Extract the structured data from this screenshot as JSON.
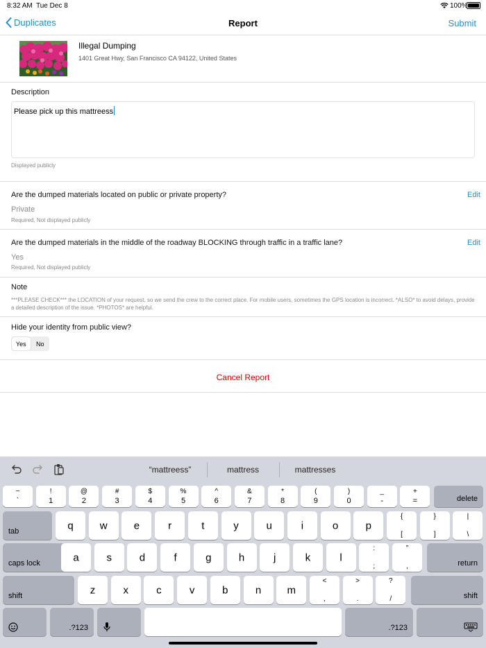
{
  "status": {
    "time": "8:32 AM",
    "day": "Tue Dec 8",
    "battery": "100%"
  },
  "nav": {
    "back_label": "Duplicates",
    "title": "Report",
    "submit_label": "Submit"
  },
  "report": {
    "title": "Illegal Dumping",
    "address": "1401 Great Hwy, San Francisco CA 94122, United States"
  },
  "description": {
    "label": "Description",
    "value": "Please pick up this mattreess",
    "hint": "Displayed publicly"
  },
  "q1": {
    "question": "Are the dumped materials located on public or private property?",
    "edit": "Edit",
    "answer": "Private",
    "hint": "Required, Not displayed publicly"
  },
  "q2": {
    "question": "Are the dumped materials in the middle of the roadway BLOCKING through traffic in a traffic lane?",
    "edit": "Edit",
    "answer": "Yes",
    "hint": "Required, Not displayed publicly"
  },
  "note": {
    "label": "Note",
    "text": "***PLEASE CHECK*** the LOCATION of your request, so we send the crew to the correct place. For mobile users, sometimes the GPS location is incorrect. *ALSO* to avoid delays, provide a detailed description of the issue. *PHOTOS* are helpful."
  },
  "identity": {
    "question": "Hide your identity from public view?",
    "yes": "Yes",
    "no": "No",
    "selected": "Yes"
  },
  "cancel_label": "Cancel Report",
  "colors": {
    "accent": "#1e8fc9",
    "danger": "#d90000"
  },
  "keyboard": {
    "suggestions": [
      "“mattreess”",
      "mattress",
      "mattresses"
    ],
    "row1": [
      {
        "top": "~",
        "bot": "`"
      },
      {
        "top": "!",
        "bot": "1"
      },
      {
        "top": "@",
        "bot": "2"
      },
      {
        "top": "#",
        "bot": "3"
      },
      {
        "top": "$",
        "bot": "4"
      },
      {
        "top": "%",
        "bot": "5"
      },
      {
        "top": "^",
        "bot": "6"
      },
      {
        "top": "&",
        "bot": "7"
      },
      {
        "top": "*",
        "bot": "8"
      },
      {
        "top": "(",
        "bot": "9"
      },
      {
        "top": ")",
        "bot": "0"
      },
      {
        "top": "_",
        "bot": "-"
      },
      {
        "top": "+",
        "bot": "="
      }
    ],
    "delete": "delete",
    "tab": "tab",
    "row2": [
      "q",
      "w",
      "e",
      "r",
      "t",
      "y",
      "u",
      "i",
      "o",
      "p"
    ],
    "row2_extra": [
      {
        "top": "{",
        "bot": "["
      },
      {
        "top": "}",
        "bot": "]"
      },
      {
        "top": "|",
        "bot": "\\"
      }
    ],
    "caps": "caps lock",
    "row3": [
      "a",
      "s",
      "d",
      "f",
      "g",
      "h",
      "j",
      "k",
      "l"
    ],
    "row3_extra": [
      {
        "top": ":",
        "bot": ";"
      },
      {
        "top": "”",
        "bot": ","
      }
    ],
    "return": "return",
    "shift": "shift",
    "row4": [
      "z",
      "x",
      "c",
      "v",
      "b",
      "n",
      "m"
    ],
    "row4_extra": [
      {
        "top": "<",
        "bot": ","
      },
      {
        "top": ">",
        "bot": "."
      },
      {
        "top": "?",
        "bot": "/"
      }
    ],
    "numbers_label": ".?123"
  }
}
